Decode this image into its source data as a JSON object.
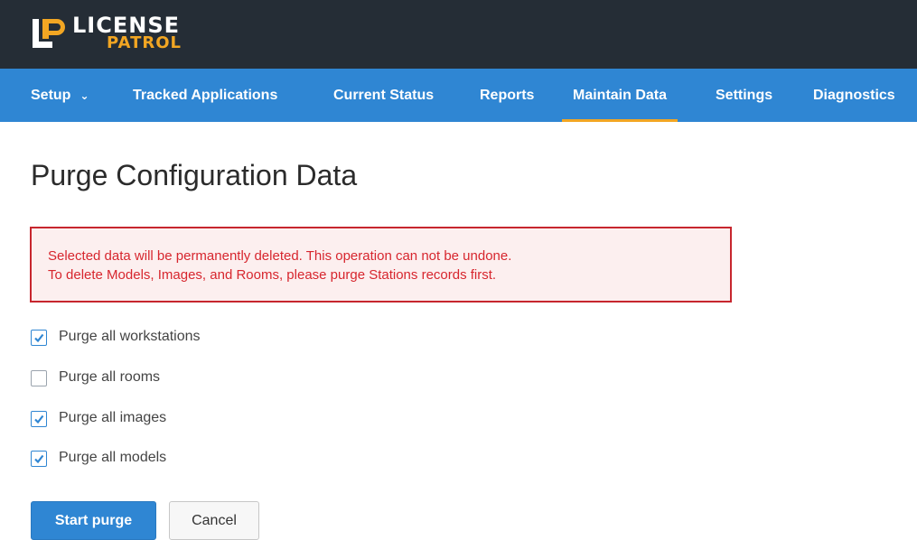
{
  "brand": {
    "line1": "LICENSE",
    "line2": "PATROL",
    "accent_color": "#f2a623"
  },
  "nav": {
    "items": [
      {
        "label": "Setup",
        "has_dropdown": true
      },
      {
        "label": "Tracked Applications"
      },
      {
        "label": "Current Status"
      },
      {
        "label": "Reports"
      },
      {
        "label": "Maintain Data",
        "active": true
      },
      {
        "label": "Settings"
      },
      {
        "label": "Diagnostics"
      }
    ],
    "dropdown_icon": "chevron-down-icon"
  },
  "page": {
    "title": "Purge Configuration Data"
  },
  "alert": {
    "line1": "Selected data will be permanently deleted. This operation can not be undone.",
    "line2": "To delete Models, Images, and Rooms, please purge Stations records first.",
    "color": "#d7262e"
  },
  "options": [
    {
      "label": "Purge all workstations",
      "checked": true
    },
    {
      "label": "Purge all rooms",
      "checked": false
    },
    {
      "label": "Purge all images",
      "checked": true
    },
    {
      "label": "Purge all models",
      "checked": true
    }
  ],
  "actions": {
    "start_label": "Start purge",
    "cancel_label": "Cancel"
  },
  "colors": {
    "topbar": "#252d36",
    "navbar": "#2f86d3",
    "primary": "#2f86d3"
  }
}
